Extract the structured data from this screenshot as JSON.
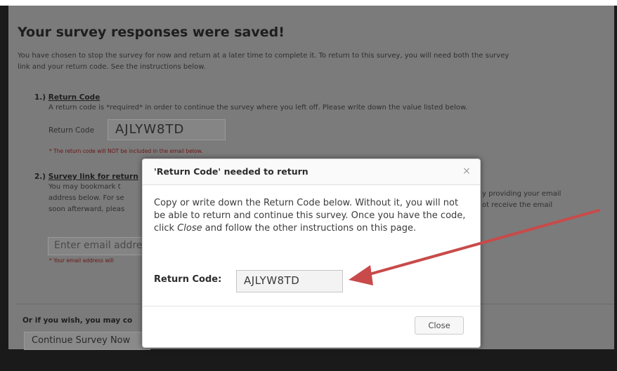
{
  "page": {
    "title": "Your survey responses were saved!",
    "intro_line1": "You have chosen to stop the survey for now and return at a later time to complete it. To return to this survey, you will need both the survey",
    "intro_line2": "link and your return code. See the instructions below."
  },
  "section1": {
    "heading_prefix": "1.) ",
    "heading": "Return Code",
    "desc": "A return code is *required* in order to continue the survey where you left off. Please write down the value listed below.",
    "field_label": "Return Code",
    "code_value": "AJLYW8TD",
    "note": "* The return code will NOT be included in the email below."
  },
  "section2": {
    "heading_prefix": "2.) ",
    "heading": "Survey link for return",
    "line1_left": "You may bookmark t",
    "line1_right": "y providing your email",
    "line2_left": "address below. For se",
    "line2_right": "ot receive the email",
    "line3_left": "soon afterward, pleas",
    "email_placeholder": "Enter email addre",
    "email_note": "* Your email address will"
  },
  "footer": {
    "or_text": "Or if you wish, you may co",
    "continue_button": "Continue Survey Now"
  },
  "modal": {
    "title": "'Return Code' needed to return",
    "close_glyph": "×",
    "msg_part1": "Copy or write down the Return Code below. Without it, you will not be able to return and continue this survey. Once you have the code, click ",
    "msg_close_word": "Close",
    "msg_part2": " and follow the other instructions on this page.",
    "code_label": "Return Code:",
    "code_value": "AJLYW8TD",
    "close_button": "Close"
  },
  "colors": {
    "overlay": "#7b7b7b",
    "arrow": "#c94a4a",
    "note_red": "#6b1414"
  }
}
